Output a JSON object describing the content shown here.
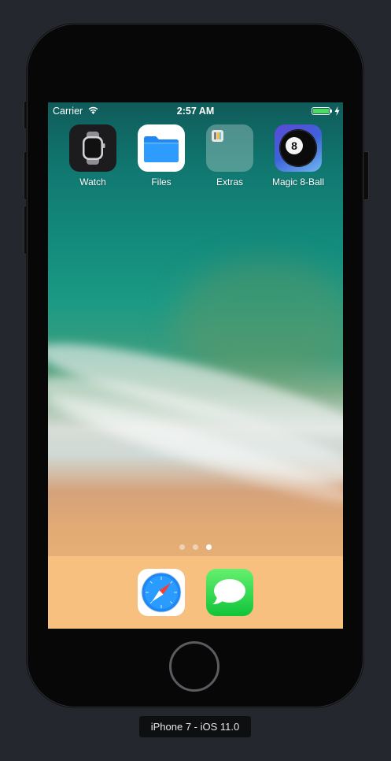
{
  "device": {
    "label": "iPhone 7 - iOS 11.0"
  },
  "status_bar": {
    "carrier": "Carrier",
    "time": "2:57 AM",
    "battery_color": "#4cd964"
  },
  "home_screen": {
    "apps": [
      {
        "label": "Watch",
        "icon": "watch-icon"
      },
      {
        "label": "Files",
        "icon": "files-icon"
      },
      {
        "label": "Extras",
        "icon": "folder-icon"
      },
      {
        "label": "Magic 8-Ball",
        "icon": "magic-8-ball-icon",
        "glyph": "8"
      }
    ],
    "page_count": 3,
    "current_page": 3
  },
  "dock": {
    "apps": [
      {
        "icon": "safari-icon"
      },
      {
        "icon": "messages-icon"
      }
    ]
  },
  "colors": {
    "stage_background": "#24272d",
    "dock": "#f7c07e"
  }
}
